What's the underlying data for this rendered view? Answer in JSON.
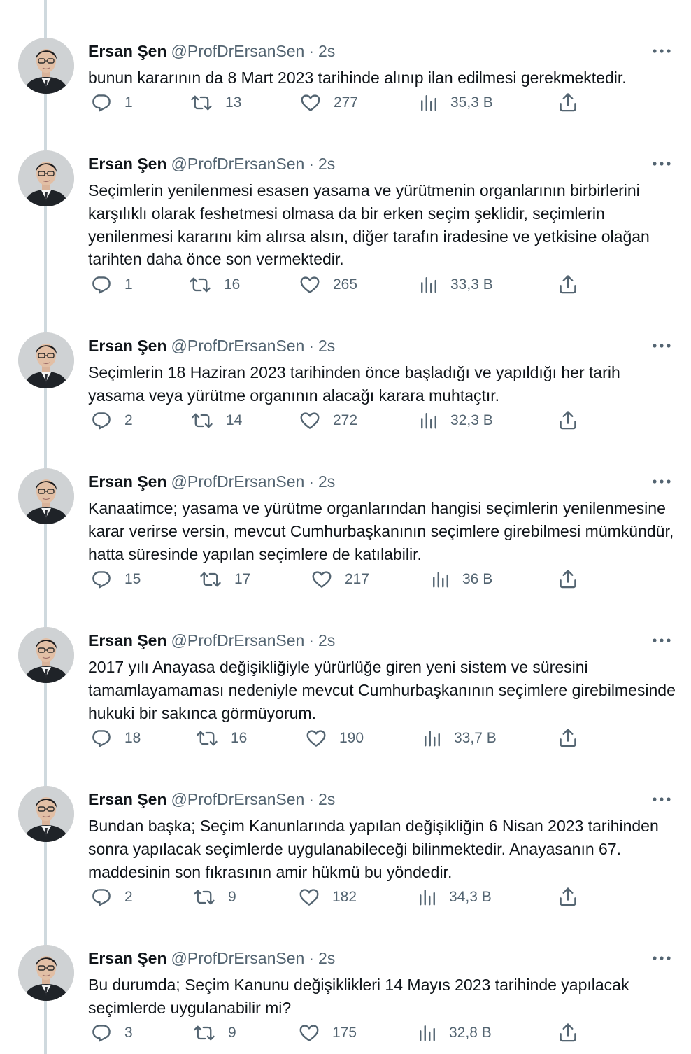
{
  "author": {
    "name": "Ersan Şen",
    "handle": "@ProfDrErsanSen",
    "separator": "·",
    "time": "2s"
  },
  "tweets": [
    {
      "text": "bunun kararının da 8 Mart 2023 tarihinde alınıp ilan edilmesi gerekmektedir.",
      "replies": "1",
      "retweets": "13",
      "likes": "277",
      "views": "35,3 B"
    },
    {
      "text": "Seçimlerin yenilenmesi esasen yasama ve yürütmenin organlarının birbirlerini karşılıklı olarak feshetmesi olmasa da bir erken seçim şeklidir, seçimlerin yenilenmesi kararını kim alırsa alsın, diğer tarafın iradesine ve yetkisine olağan tarihten daha önce son vermektedir.",
      "replies": "1",
      "retweets": "16",
      "likes": "265",
      "views": "33,3 B"
    },
    {
      "text": "Seçimlerin 18 Haziran 2023 tarihinden önce başladığı ve yapıldığı her tarih yasama veya yürütme organının alacağı karara muhtaçtır.",
      "replies": "2",
      "retweets": "14",
      "likes": "272",
      "views": "32,3 B"
    },
    {
      "text": "Kanaatimce; yasama ve yürütme organlarından hangisi seçimlerin yenilenmesine karar verirse versin, mevcut Cumhurbaşkanının seçimlere girebilmesi mümkündür, hatta süresinde yapılan seçimlere de katılabilir.",
      "replies": "15",
      "retweets": "17",
      "likes": "217",
      "views": "36 B"
    },
    {
      "text": "2017 yılı Anayasa değişikliğiyle yürürlüğe giren yeni sistem ve süresini tamamlayamaması nedeniyle mevcut Cumhurbaşkanının seçimlere girebilmesinde hukuki bir sakınca görmüyorum.",
      "replies": "18",
      "retweets": "16",
      "likes": "190",
      "views": "33,7 B"
    },
    {
      "text": "Bundan başka; Seçim Kanunlarında yapılan değişikliğin 6 Nisan 2023 tarihinden sonra yapılacak seçimlerde uygulanabileceği bilinmektedir. Anayasanın 67. maddesinin son fıkrasının amir hükmü bu yöndedir.",
      "replies": "2",
      "retweets": "9",
      "likes": "182",
      "views": "34,3 B"
    },
    {
      "text": "Bu durumda; Seçim Kanunu değişiklikleri 14 Mayıs 2023 tarihinde yapılacak seçimlerde uygulanabilir mi?",
      "replies": "3",
      "retweets": "9",
      "likes": "175",
      "views": "32,8 B"
    }
  ],
  "icons": {
    "avatar": "avatar",
    "more": "more-icon",
    "reply": "reply-icon",
    "retweet": "retweet-icon",
    "like": "like-icon",
    "views": "views-icon",
    "share": "share-icon"
  },
  "colors": {
    "text": "#0f1419",
    "secondary": "#536471",
    "thread_line": "#cfd9de",
    "background": "#ffffff"
  }
}
